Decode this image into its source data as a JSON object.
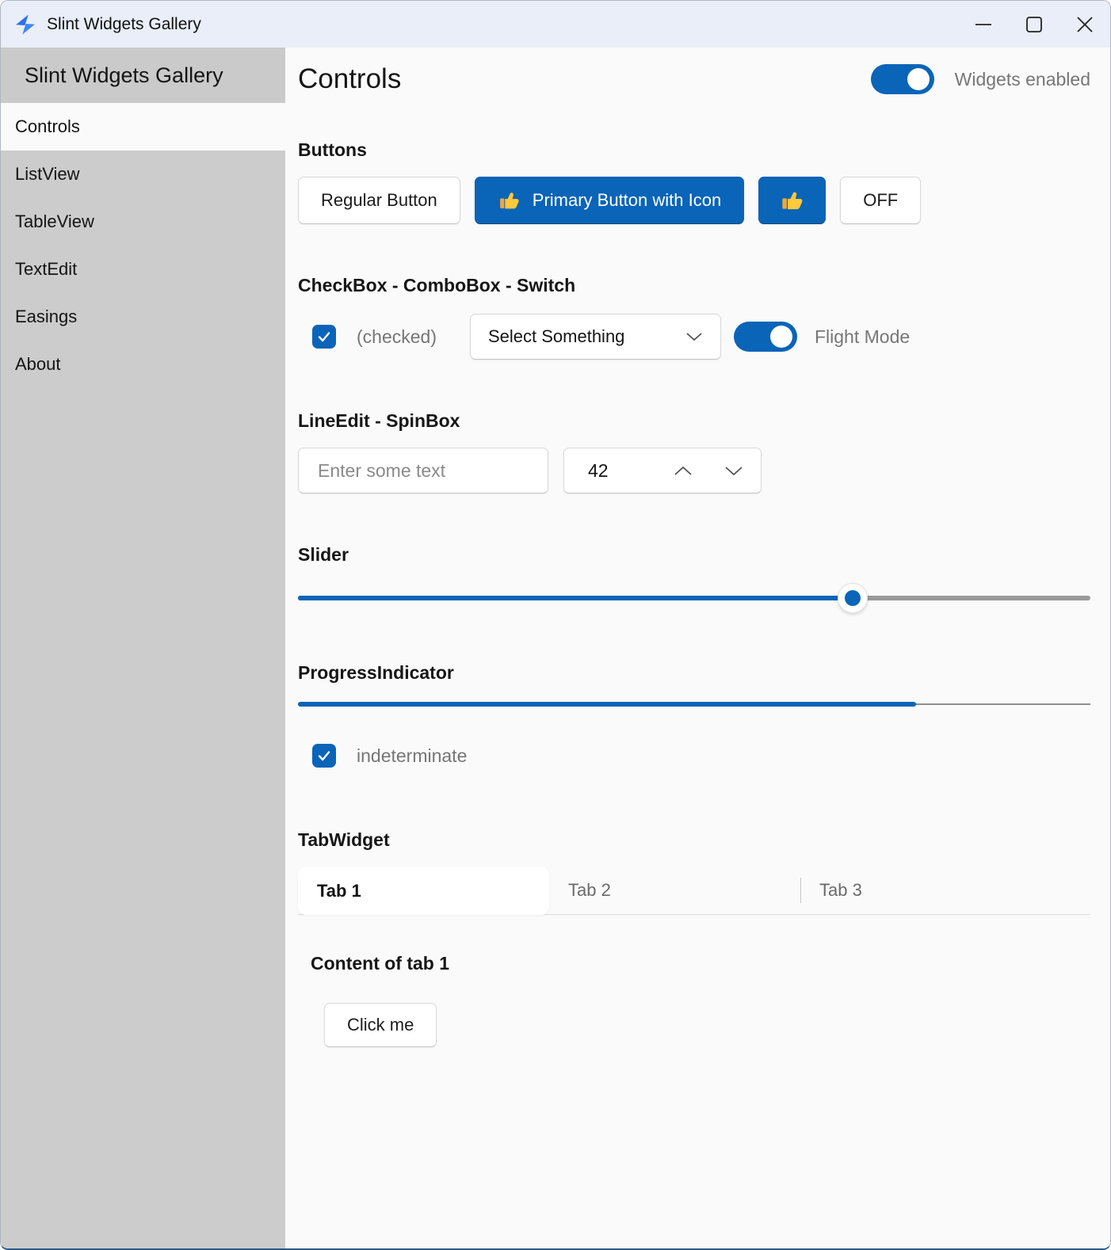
{
  "titlebar": {
    "title": "Slint Widgets Gallery",
    "controls": {
      "minimize": "minimize",
      "maximize": "maximize",
      "close": "close"
    }
  },
  "sidebar": {
    "header": "Slint Widgets Gallery",
    "items": [
      {
        "label": "Controls",
        "selected": true
      },
      {
        "label": "ListView",
        "selected": false
      },
      {
        "label": "TableView",
        "selected": false
      },
      {
        "label": "TextEdit",
        "selected": false
      },
      {
        "label": "Easings",
        "selected": false
      },
      {
        "label": "About",
        "selected": false
      }
    ]
  },
  "header": {
    "title": "Controls",
    "widgets_enabled_label": "Widgets enabled",
    "widgets_enabled": true
  },
  "sections": {
    "buttons": {
      "heading": "Buttons",
      "regular_label": "Regular Button",
      "primary_label": "Primary Button with Icon",
      "off_label": "OFF"
    },
    "checks": {
      "heading": "CheckBox - ComboBox - Switch",
      "checkbox_label": "(checked)",
      "checkbox_checked": true,
      "combobox_value": "Select Something",
      "switch_label": "Flight Mode",
      "switch_on": true
    },
    "lineedit": {
      "heading": "LineEdit - SpinBox",
      "placeholder": "Enter some text",
      "spinbox_value": "42"
    },
    "slider": {
      "heading": "Slider",
      "value_percent": 70
    },
    "progress": {
      "heading": "ProgressIndicator",
      "value_percent": 78,
      "indeterminate_label": "indeterminate",
      "indeterminate_checked": true
    },
    "tabs": {
      "heading": "TabWidget",
      "tab1": "Tab 1",
      "tab2": "Tab 2",
      "tab3": "Tab 3",
      "active_tab": "Tab 1",
      "content_heading": "Content of tab 1",
      "button_label": "Click me"
    }
  },
  "colors": {
    "accent": "#0a64b8",
    "titlebar_bg": "#e9eef8",
    "sidebar_bg": "#cccccc",
    "main_bg": "#fafafa",
    "thumb_yellow": "#ffc83d"
  }
}
